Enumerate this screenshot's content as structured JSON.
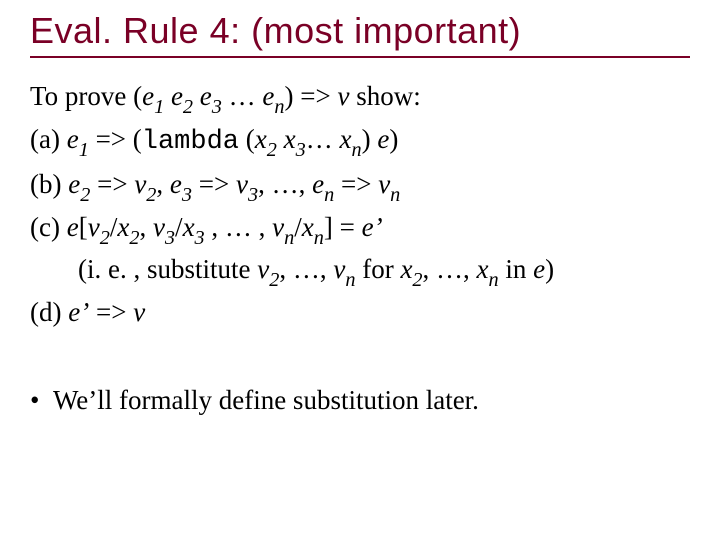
{
  "title": "Eval. Rule 4:  (most important)",
  "lines": {
    "intro_html": "To prove (<span class='em'>e</span><sub>1</sub> <span class='em'>e</span><sub>2</sub> <span class='em'>e</span><sub>3</sub> … <span class='em'>e</span><sub>n</sub>) =&gt; <span class='em'>v</span> show:",
    "a_html": "(a) <span class='em'>e</span><sub>1</sub> =&gt; (<span class='tt'>lambda</span> (<span class='em'>x</span><sub>2</sub> <span class='em'>x</span><sub>3</sub>… <span class='em'>x</span><sub>n</sub>) <span class='em'>e</span>)",
    "b_html": "(b) <span class='em'>e</span><sub>2</sub> =&gt; <span class='em'>v</span><sub>2</sub>,  <span class='em'>e</span><sub>3</sub> =&gt; <span class='em'>v</span><sub>3</sub>, …,  <span class='em'>e</span><sub>n</sub> =&gt; <span class='em'>v</span><sub>n</sub>",
    "c_html": "(c) <span class='em'>e</span>[<span class='em'>v</span><sub>2</sub>/<span class='em'>x</span><sub>2</sub>, <span class='em'>v</span><sub>3</sub>/<span class='em'>x</span><sub>3</sub> , … , <span class='em'>v</span><sub>n</sub>/<span class='em'>x</span><sub>n</sub>] = <span class='em'>e’</span>",
    "c_note_html": "(i. e. , substitute <span class='em'>v</span><sub>2</sub>, …, <span class='em'>v</span><sub>n</sub> for <span class='em'>x</span><sub>2</sub>, …, <span class='em'>x</span><sub>n</sub> in <span class='em'>e</span>)",
    "d_html": "(d) <span class='em'>e’</span> =&gt; <span class='em'>v</span>",
    "bullet_html": "•&nbsp;&nbsp;We’ll formally define substitution later."
  }
}
